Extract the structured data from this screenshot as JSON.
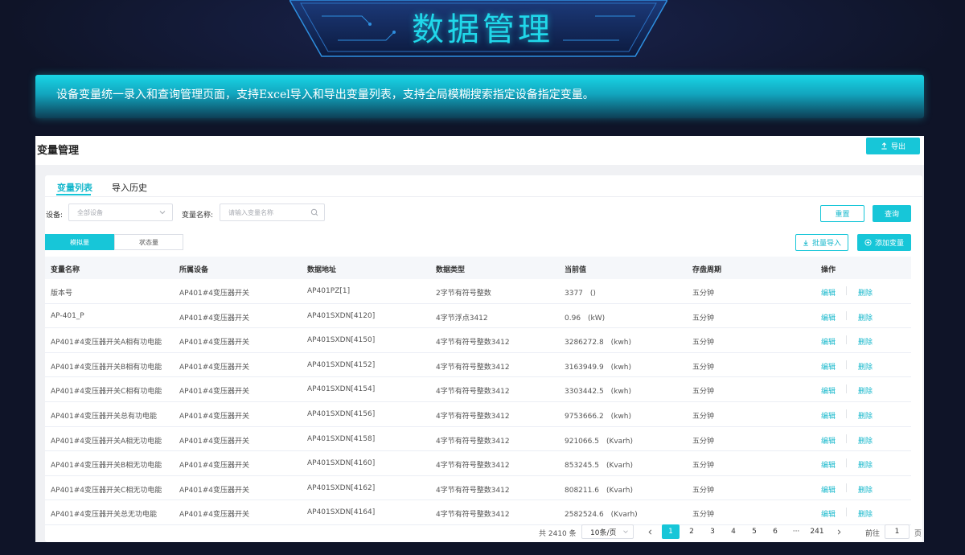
{
  "header": {
    "title": "数据管理",
    "description": "设备变量统一录入和查询管理页面，支持Excel导入和导出变量列表，支持全局模糊搜索指定设备指定变量。"
  },
  "panel": {
    "title": "变量管理",
    "export_label": "导出",
    "tabs": [
      {
        "label": "变量列表",
        "active": true
      },
      {
        "label": "导入历史",
        "active": false
      }
    ]
  },
  "filters": {
    "device_label": "设备:",
    "device_value": "全部设备",
    "name_label": "变量名称:",
    "name_placeholder": "请输入变量名称",
    "reset_label": "重置",
    "query_label": "查询"
  },
  "segment": {
    "items": [
      {
        "label": "模拟量",
        "active": true
      },
      {
        "label": "状态量",
        "active": false
      }
    ]
  },
  "actions": {
    "batch_import_label": "批量导入",
    "add_label": "添加变量"
  },
  "table": {
    "columns": [
      "变量名称",
      "所属设备",
      "数据地址",
      "数据类型",
      "当前值",
      "存盘周期",
      "操作"
    ],
    "edit_label": "编辑",
    "delete_label": "删除",
    "rows": [
      {
        "name": "版本号",
        "device": "AP401#4变压器开关",
        "address": "AP401PZ[1]",
        "type": "2字节有符号整数",
        "value": "3377　()",
        "period": "五分钟"
      },
      {
        "name": "AP-401_P",
        "device": "AP401#4变压器开关",
        "address": "AP401SXDN[4120]",
        "type": "4字节浮点3412",
        "value": "0.96　(kW)",
        "period": "五分钟"
      },
      {
        "name": "AP401#4变压器开关A相有功电能",
        "device": "AP401#4变压器开关",
        "address": "AP401SXDN[4150]",
        "type": "4字节有符号整数3412",
        "value": "3286272.8　(kwh)",
        "period": "五分钟"
      },
      {
        "name": "AP401#4变压器开关B相有功电能",
        "device": "AP401#4变压器开关",
        "address": "AP401SXDN[4152]",
        "type": "4字节有符号整数3412",
        "value": "3163949.9　(kwh)",
        "period": "五分钟"
      },
      {
        "name": "AP401#4变压器开关C相有功电能",
        "device": "AP401#4变压器开关",
        "address": "AP401SXDN[4154]",
        "type": "4字节有符号整数3412",
        "value": "3303442.5　(kwh)",
        "period": "五分钟"
      },
      {
        "name": "AP401#4变压器开关总有功电能",
        "device": "AP401#4变压器开关",
        "address": "AP401SXDN[4156]",
        "type": "4字节有符号整数3412",
        "value": "9753666.2　(kwh)",
        "period": "五分钟"
      },
      {
        "name": "AP401#4变压器开关A相无功电能",
        "device": "AP401#4变压器开关",
        "address": "AP401SXDN[4158]",
        "type": "4字节有符号整数3412",
        "value": "921066.5　(Kvarh)",
        "period": "五分钟"
      },
      {
        "name": "AP401#4变压器开关B相无功电能",
        "device": "AP401#4变压器开关",
        "address": "AP401SXDN[4160]",
        "type": "4字节有符号整数3412",
        "value": "853245.5　(Kvarh)",
        "period": "五分钟"
      },
      {
        "name": "AP401#4变压器开关C相无功电能",
        "device": "AP401#4变压器开关",
        "address": "AP401SXDN[4162]",
        "type": "4字节有符号整数3412",
        "value": "808211.6　(Kvarh)",
        "period": "五分钟"
      },
      {
        "name": "AP401#4变压器开关总无功电能",
        "device": "AP401#4变压器开关",
        "address": "AP401SXDN[4164]",
        "type": "4字节有符号整数3412",
        "value": "2582524.6　(Kvarh)",
        "period": "五分钟"
      }
    ]
  },
  "pagination": {
    "total_label": "共 2410 条",
    "page_size": "10条/页",
    "pages": [
      "1",
      "2",
      "3",
      "4",
      "5",
      "6",
      "···",
      "241"
    ],
    "current": "1",
    "goto_prefix": "前往",
    "goto_value": "1",
    "goto_suffix": "页"
  },
  "colors": {
    "accent": "#17c6d8",
    "background": "#0f1428",
    "title_glow": "#20d8ea"
  }
}
